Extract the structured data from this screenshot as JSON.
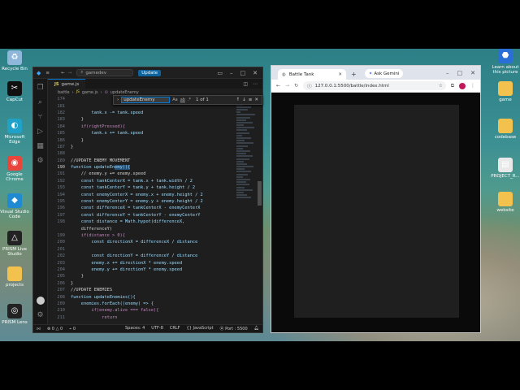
{
  "desktop": {
    "icons_left": [
      {
        "label": "Recycle Bin",
        "icon": "recycle-bin-icon",
        "color": "#8fb7d9"
      },
      {
        "label": "CapCut",
        "icon": "capcut-icon",
        "color": "#111111"
      },
      {
        "label": "Microsoft Edge",
        "icon": "edge-icon",
        "color": "#1fa1c8"
      },
      {
        "label": "Google Chrome",
        "icon": "chrome-icon",
        "color": "#e8453c"
      },
      {
        "label": "Visual Studio Code",
        "icon": "vscode-icon",
        "color": "#1f8ad2"
      },
      {
        "label": "PRISM Live Studio",
        "icon": "prism-icon",
        "color": "#222222"
      },
      {
        "label": "projects",
        "icon": "folder-icon",
        "color": "#f2c14e"
      },
      {
        "label": "PRISM Lens",
        "icon": "prism-lens-icon",
        "color": "#222222"
      }
    ],
    "icons_right": [
      {
        "label": "Learn about this picture",
        "icon": "learn-icon",
        "color": "#2a6fd6"
      },
      {
        "label": "game",
        "icon": "folder-icon",
        "color": "#f2c14e"
      },
      {
        "label": "codebase",
        "icon": "folder-icon",
        "color": "#f2c14e"
      },
      {
        "label": "PROJECT_R...",
        "icon": "document-icon",
        "color": "#e9e9e9"
      },
      {
        "label": "website",
        "icon": "folder-icon",
        "color": "#f2c14e"
      }
    ]
  },
  "vscode": {
    "search_text": "gamedev",
    "update_label": "Update",
    "tab_label": "game.js",
    "tab_prefix": "JS",
    "breadcrumb": [
      "battle",
      "game.js",
      "updateEnemy"
    ],
    "find": {
      "query": "updateEnemy",
      "case_label": "Aa",
      "word_label": "ab",
      "regex_label": ".*",
      "count": "1 of 1"
    },
    "status": {
      "errors": "0",
      "warnings": "0",
      "spaces": "Spaces: 4",
      "encoding": "UTF-8",
      "eol": "CRLF",
      "language": "JavaScript",
      "port": "Port : 5500"
    },
    "lines": [
      {
        "n": "174",
        "t": ""
      },
      {
        "n": "181",
        "t": ""
      },
      {
        "n": "182",
        "t": "        tank.x -= tank.speed"
      },
      {
        "n": "183",
        "t": "    }"
      },
      {
        "n": "184",
        "t": "    if(rightPressed){"
      },
      {
        "n": "185",
        "t": "        tank.x += tank.speed"
      },
      {
        "n": "186",
        "t": "    }"
      },
      {
        "n": "187",
        "t": "}"
      },
      {
        "n": "188",
        "t": ""
      },
      {
        "n": "189",
        "t": "//UPDATE ENEMY MOVEMENT"
      },
      {
        "n": "190",
        "t": "function updateEnemy(){"
      },
      {
        "n": "191",
        "t": "    // enemy.y += enemy.speed"
      },
      {
        "n": "192",
        "t": "    const tankCenterX = tank.x + tank.width / 2"
      },
      {
        "n": "193",
        "t": "    const tankCenterY = tank.y + tank.height / 2"
      },
      {
        "n": "194",
        "t": "    const enemyCenterX = enemy.x + enemy.height / 2"
      },
      {
        "n": "195",
        "t": "    const enemyCenterY = enemy.y + enemy.height / 2"
      },
      {
        "n": "196",
        "t": "    const differenceX = tankCenterX - enemyCenterX"
      },
      {
        "n": "197",
        "t": "    const differenceY = tankCenterY - enemyCenterY"
      },
      {
        "n": "198",
        "t": "    const distance = Math.hypot(differenceX,"
      },
      {
        "n": "",
        "t": "    differenceY)"
      },
      {
        "n": "199",
        "t": "    if(distance > 0){"
      },
      {
        "n": "200",
        "t": "        const directionX = differenceX / distance"
      },
      {
        "n": "201",
        "t": ""
      },
      {
        "n": "202",
        "t": "        const directionY = differenceY / distance"
      },
      {
        "n": "203",
        "t": "        enemy.x += directionX * enemy.speed"
      },
      {
        "n": "204",
        "t": "        enemy.y += directionY * enemy.speed"
      },
      {
        "n": "205",
        "t": "    }"
      },
      {
        "n": "206",
        "t": "}"
      },
      {
        "n": "207",
        "t": "//UPDATE ENEMIES"
      },
      {
        "n": "208",
        "t": "function updateEnemies(){"
      },
      {
        "n": "209",
        "t": "    enemies.forEach((enemy) => {"
      },
      {
        "n": "210",
        "t": "        if(enemy.alive === false){"
      },
      {
        "n": "211",
        "t": "            return"
      }
    ]
  },
  "chrome": {
    "tab_title": "Battle Tank",
    "gemini_label": "Ask Gemini",
    "url": "127.0.0.1:5500/battle/index.html",
    "profile_color": "#c2185b",
    "canvas_color": "#1f1f1f",
    "viewport_color": "#0a0a0a"
  }
}
